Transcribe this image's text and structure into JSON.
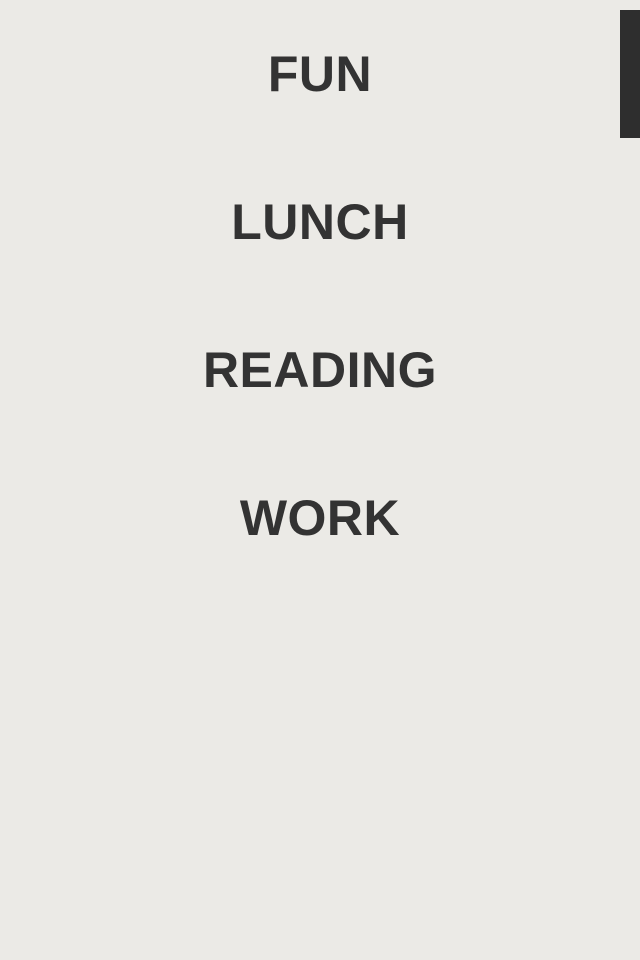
{
  "categories": [
    {
      "label": "FUN"
    },
    {
      "label": "LUNCH"
    },
    {
      "label": "READING"
    },
    {
      "label": "WORK"
    }
  ],
  "colors": {
    "background": "#EBEAE6",
    "text": "#333333",
    "scrollbar": "#2E2E2E"
  }
}
